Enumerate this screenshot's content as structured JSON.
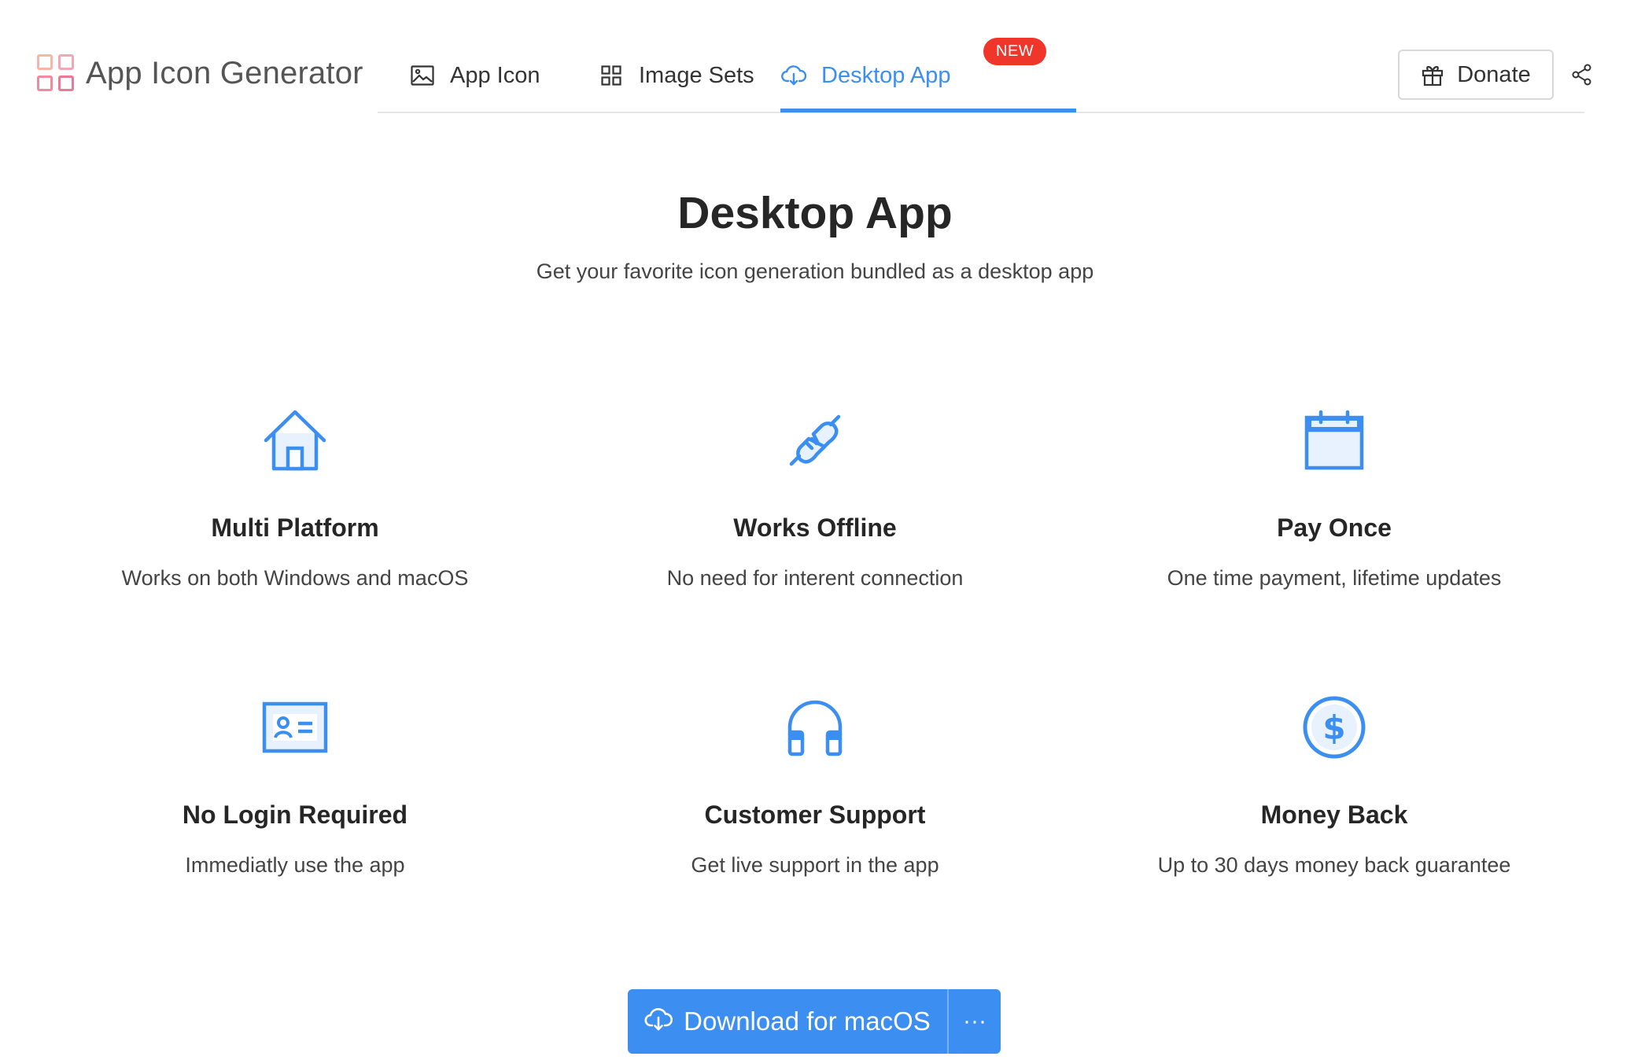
{
  "header": {
    "logo_text": "App Icon Generator",
    "logo_icon": "grid-logo-icon",
    "tabs": [
      {
        "label": "App Icon",
        "icon": "image-icon",
        "active": false
      },
      {
        "label": "Image Sets",
        "icon": "grid-icon",
        "active": false
      },
      {
        "label": "Desktop App",
        "icon": "cloud-download-icon",
        "active": true
      }
    ],
    "new_badge": "NEW",
    "donate_label": "Donate",
    "donate_icon": "gift-icon",
    "share_icon": "share-icon"
  },
  "hero": {
    "title": "Desktop App",
    "subtitle": "Get your favorite icon generation bundled as a desktop app"
  },
  "features": [
    {
      "title": "Multi Platform",
      "description": "Works on both Windows and macOS",
      "icon": "home-icon"
    },
    {
      "title": "Works Offline",
      "description": "No need for interent connection",
      "icon": "plug-icon"
    },
    {
      "title": "Pay Once",
      "description": "One time payment, lifetime updates",
      "icon": "calendar-icon"
    },
    {
      "title": "No Login Required",
      "description": "Immediatly use the app",
      "icon": "id-card-icon"
    },
    {
      "title": "Customer Support",
      "description": "Get live support in the app",
      "icon": "headphones-icon"
    },
    {
      "title": "Money Back",
      "description": "Up to 30 days money back guarantee",
      "icon": "dollar-icon"
    }
  ],
  "download": {
    "label": "Download for macOS",
    "more_label": "···",
    "icon": "cloud-download-icon"
  },
  "colors": {
    "accent": "#3c8ff0",
    "badge": "#f0362b",
    "text": "#262626"
  }
}
